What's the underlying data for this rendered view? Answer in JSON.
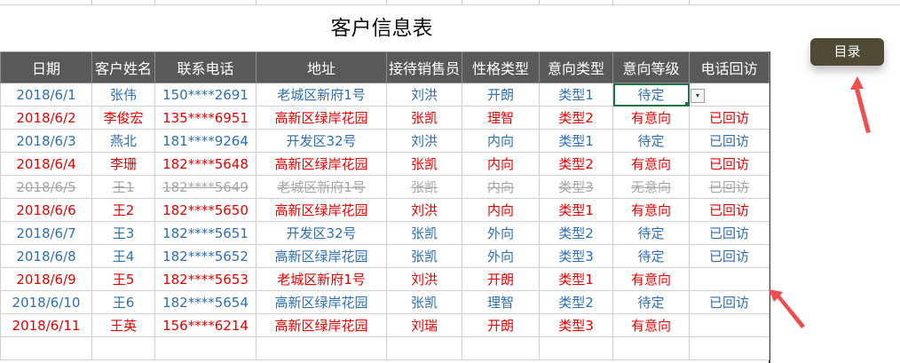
{
  "sheet": {
    "title": "客户信息表",
    "headers": [
      "日期",
      "客户姓名",
      "联系电话",
      "地址",
      "接待销售员",
      "性格类型",
      "意向类型",
      "意向等级",
      "电话回访"
    ],
    "rows": [
      [
        "2018/6/1",
        "张伟",
        "150****2691",
        "老城区新府1号",
        "刘洪",
        "开朗",
        "类型1",
        "待定",
        ""
      ],
      [
        "2018/6/2",
        "李俊宏",
        "135****6951",
        "高新区绿岸花园",
        "张凯",
        "理智",
        "类型2",
        "有意向",
        "已回访"
      ],
      [
        "2018/6/3",
        "燕北",
        "181****9264",
        "开发区32号",
        "刘洪",
        "内向",
        "类型1",
        "待定",
        "已回访"
      ],
      [
        "2018/6/4",
        "李珊",
        "182****5648",
        "高新区绿岸花园",
        "张凯",
        "内向",
        "类型2",
        "有意向",
        "已回访"
      ],
      [
        "2018/6/5",
        "王1",
        "182****5649",
        "老城区新府1号",
        "张凯",
        "内向",
        "类型3",
        "无意向",
        "已回访"
      ],
      [
        "2018/6/6",
        "王2",
        "182****5650",
        "高新区绿岸花园",
        "刘洪",
        "内向",
        "类型1",
        "有意向",
        "已回访"
      ],
      [
        "2018/6/7",
        "王3",
        "182****5651",
        "开发区32号",
        "张凯",
        "外向",
        "类型2",
        "待定",
        "已回访"
      ],
      [
        "2018/6/8",
        "王4",
        "182****5652",
        "高新区绿岸花园",
        "张凯",
        "外向",
        "类型3",
        "待定",
        "已回访"
      ],
      [
        "2018/6/9",
        "王5",
        "182****5653",
        "老城区新府1号",
        "刘洪",
        "开朗",
        "类型1",
        "有意向",
        ""
      ],
      [
        "2018/6/10",
        "王6",
        "182****5654",
        "高新区绿岸花园",
        "张凯",
        "理智",
        "类型2",
        "待定",
        "已回访"
      ],
      [
        "2018/6/11",
        "王英",
        "156****6214",
        "高新区绿岸花园",
        "刘瑞",
        "开朗",
        "类型3",
        "有意向",
        ""
      ]
    ],
    "row_styles": [
      "blue",
      "red",
      "blue",
      "red",
      "gray",
      "red",
      "blue",
      "blue",
      "red",
      "blue",
      "red"
    ],
    "empty_rows": 1
  },
  "dropdown_arrow": "▾",
  "menu_button_label": "目录",
  "colors": {
    "header_bg": "#595959",
    "text_blue": "#2f6fb0",
    "text_red": "#e60000",
    "text_gray": "#a6a6a6",
    "selection": "#217346",
    "button_bg": "#4e4a33",
    "arrow": "#ef4f4f"
  },
  "icons": {
    "dropdown": "chevron-down-icon",
    "arrows": "red-arrow-icon"
  }
}
